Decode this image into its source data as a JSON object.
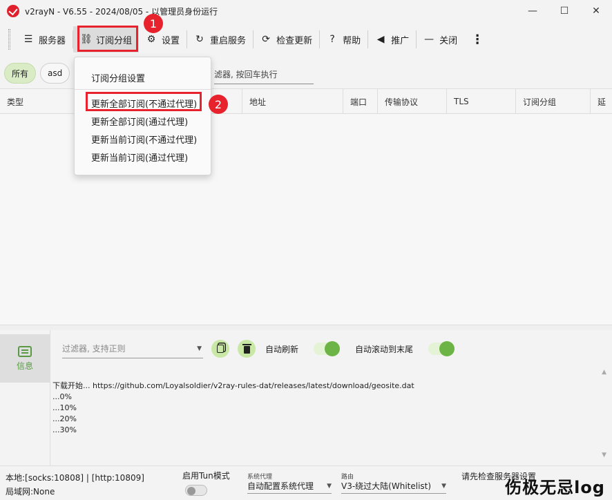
{
  "window": {
    "title": "v2rayN - V6.55 - 2024/08/05 - 以管理员身份运行",
    "minimize": "—",
    "maximize": "☐",
    "close": "✕"
  },
  "toolbar": {
    "items": [
      {
        "label": "服务器",
        "icon": "server-icon"
      },
      {
        "label": "订阅分组",
        "icon": "subscription-icon"
      },
      {
        "label": "设置",
        "icon": "gear-icon"
      },
      {
        "label": "重启服务",
        "icon": "restart-icon"
      },
      {
        "label": "检查更新",
        "icon": "refresh-icon"
      },
      {
        "label": "帮助",
        "icon": "help-icon"
      },
      {
        "label": "推广",
        "icon": "speaker-icon"
      },
      {
        "label": "关闭",
        "icon": "minus-icon"
      }
    ],
    "more": "⋮"
  },
  "filters": {
    "chips": [
      "所有",
      "asd"
    ],
    "server_filter_placeholder": "滤器, 按回车执行"
  },
  "table": {
    "headers": [
      "类型",
      "地址",
      "端口",
      "传输协议",
      "TLS",
      "订阅分组",
      "延"
    ]
  },
  "menu": {
    "items": [
      "订阅分组设置",
      "更新全部订阅(不通过代理)",
      "更新全部订阅(通过代理)",
      "更新当前订阅(不通过代理)",
      "更新当前订阅(通过代理)"
    ]
  },
  "annotations": {
    "badge_1": "1",
    "badge_2": "2",
    "color": "#e8222d"
  },
  "info_panel": {
    "tab_label": "信息",
    "filter_placeholder": "过滤器, 支持正则",
    "auto_refresh_label": "自动刷新",
    "auto_scroll_label": "自动滚动到末尾",
    "log_lines": [
      "下载开始...   https://github.com/Loyalsoldier/v2ray-rules-dat/releases/latest/download/geosite.dat",
      "...0%",
      "...10%",
      "...20%",
      "...30%"
    ]
  },
  "status": {
    "local": "本地:[socks:10808] | [http:10809]",
    "lan": "局域网:None",
    "tun_label": "启用Tun模式",
    "sys_proxy_caption": "系统代理",
    "sys_proxy_value": "自动配置系统代理",
    "routing_caption": "路由",
    "routing_value": "V3-绕过大陆(Whitelist)",
    "server_status": "请先检查服务器设置"
  },
  "watermark": "伤极无忌log",
  "theme": {
    "accent_green": "#6cb445",
    "highlight_red": "#e8222d"
  }
}
